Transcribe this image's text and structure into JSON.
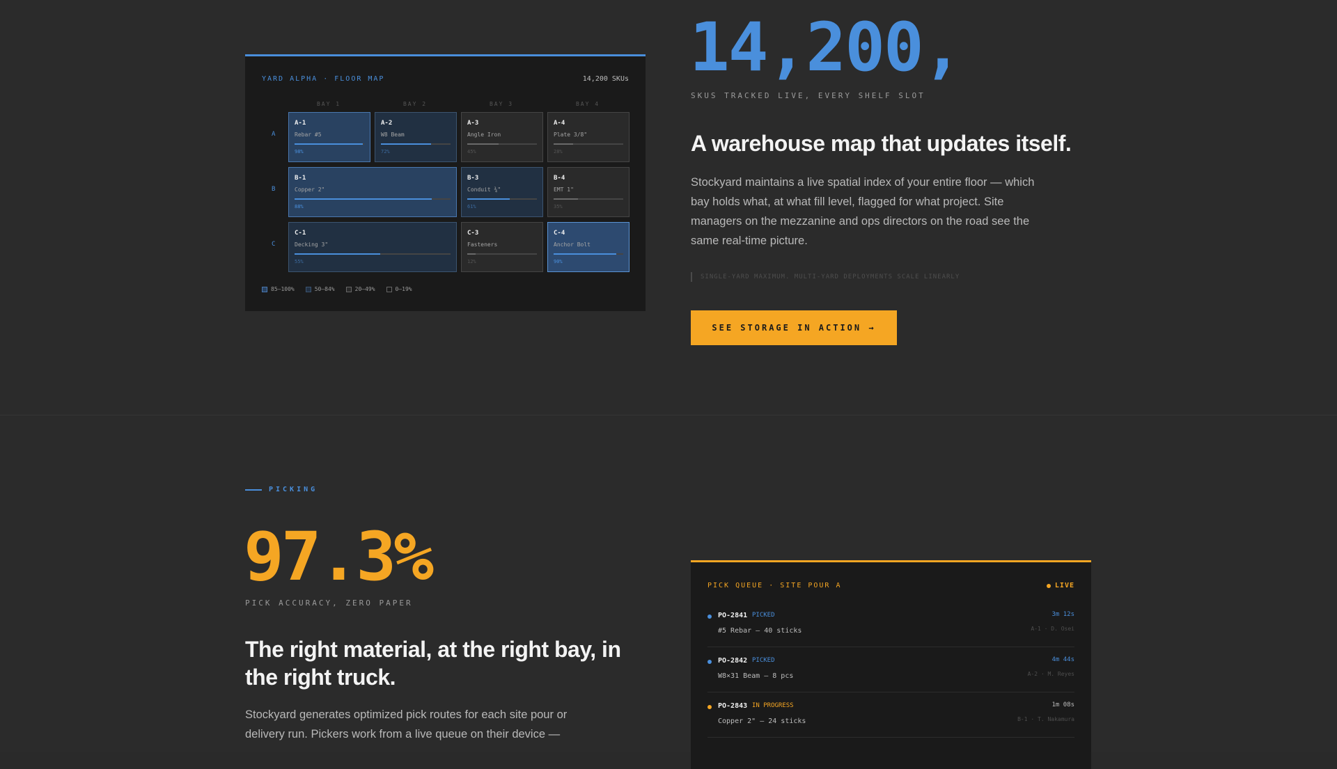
{
  "colors": {
    "background": "#2b2b2b",
    "card": "#1a1a1a",
    "accent_blue": "#4a8fdc",
    "accent_orange": "#f5a623",
    "text_primary": "#f3f3f3",
    "text_body": "#b9b9b9"
  },
  "storage": {
    "big_number": "14,200,",
    "caption": "SKUS TRACKED LIVE, EVERY SHELF SLOT",
    "heading": "A warehouse map that updates itself.",
    "body": "Stockyard maintains a live spatial index of your entire floor — which bay holds what, at what fill level, flagged for what project. Site managers on the mezzanine and ops directors on the road see the same real-time picture.",
    "footnote": "SINGLE-YARD MAXIMUM. MULTI-YARD DEPLOYMENTS SCALE LINEARLY",
    "cta_label": "SEE STORAGE IN ACTION →"
  },
  "floor_map": {
    "title": "YARD ALPHA · FLOOR MAP",
    "sku_count": "14,200 SKUs",
    "bays": [
      "BAY 1",
      "BAY 2",
      "BAY 3",
      "BAY 4"
    ],
    "rows": [
      "A",
      "B",
      "C"
    ],
    "cells": [
      {
        "id": "A-1",
        "item": "Rebar #5",
        "pct": "98%",
        "fill": 0.98,
        "level": "high"
      },
      {
        "id": "A-2",
        "item": "W8 Beam",
        "pct": "72%",
        "fill": 0.72,
        "level": "mid"
      },
      {
        "id": "A-3",
        "item": "Angle Iron",
        "pct": "45%",
        "fill": 0.45,
        "level": "low"
      },
      {
        "id": "A-4",
        "item": "Plate 3/8\"",
        "pct": "28%",
        "fill": 0.28,
        "level": "low"
      },
      {
        "id": "B-1",
        "item": "Copper 2\"",
        "pct": "88%",
        "fill": 0.88,
        "level": "high"
      },
      {
        "id": "B-3",
        "item": "Conduit ¾\"",
        "pct": "61%",
        "fill": 0.61,
        "level": "mid"
      },
      {
        "id": "B-4",
        "item": "EMT 1\"",
        "pct": "35%",
        "fill": 0.35,
        "level": "low"
      },
      {
        "id": "C-1",
        "item": "Decking 3\"",
        "pct": "55%",
        "fill": 0.55,
        "level": "mid"
      },
      {
        "id": "C-3",
        "item": "Fasteners",
        "pct": "12%",
        "fill": 0.12,
        "level": "min"
      },
      {
        "id": "C-4",
        "item": "Anchor Bolt",
        "pct": "90%",
        "fill": 0.9,
        "level": "hl"
      }
    ],
    "legend": [
      "85–100%",
      "50–84%",
      "20–49%",
      "0–19%"
    ]
  },
  "picking": {
    "eyebrow": "PICKING",
    "big_number": "97.3%",
    "caption": "PICK ACCURACY, ZERO PAPER",
    "heading": "The right material, at the right bay, in the right truck.",
    "body": "Stockyard generates optimized pick routes for each site pour or delivery run. Pickers work from a live queue on their device —"
  },
  "pick_queue": {
    "title": "PICK QUEUE · SITE POUR A",
    "live_label": "LIVE",
    "items": [
      {
        "id": "PO-2841",
        "status": "PICKED",
        "status_color": "#4a8fdc",
        "desc": "#5 Rebar — 40 sticks",
        "time": "3m 12s",
        "loc": "A-1 · D. Osei"
      },
      {
        "id": "PO-2842",
        "status": "PICKED",
        "status_color": "#4a8fdc",
        "desc": "W8×31 Beam — 8 pcs",
        "time": "4m 44s",
        "loc": "A-2 · M. Reyes"
      },
      {
        "id": "PO-2843",
        "status": "IN PROGRESS",
        "status_color": "#f5a623",
        "desc": "Copper 2\" — 24 sticks",
        "time": "1m 08s",
        "loc": "B-1 · T. Nakamura"
      }
    ]
  }
}
